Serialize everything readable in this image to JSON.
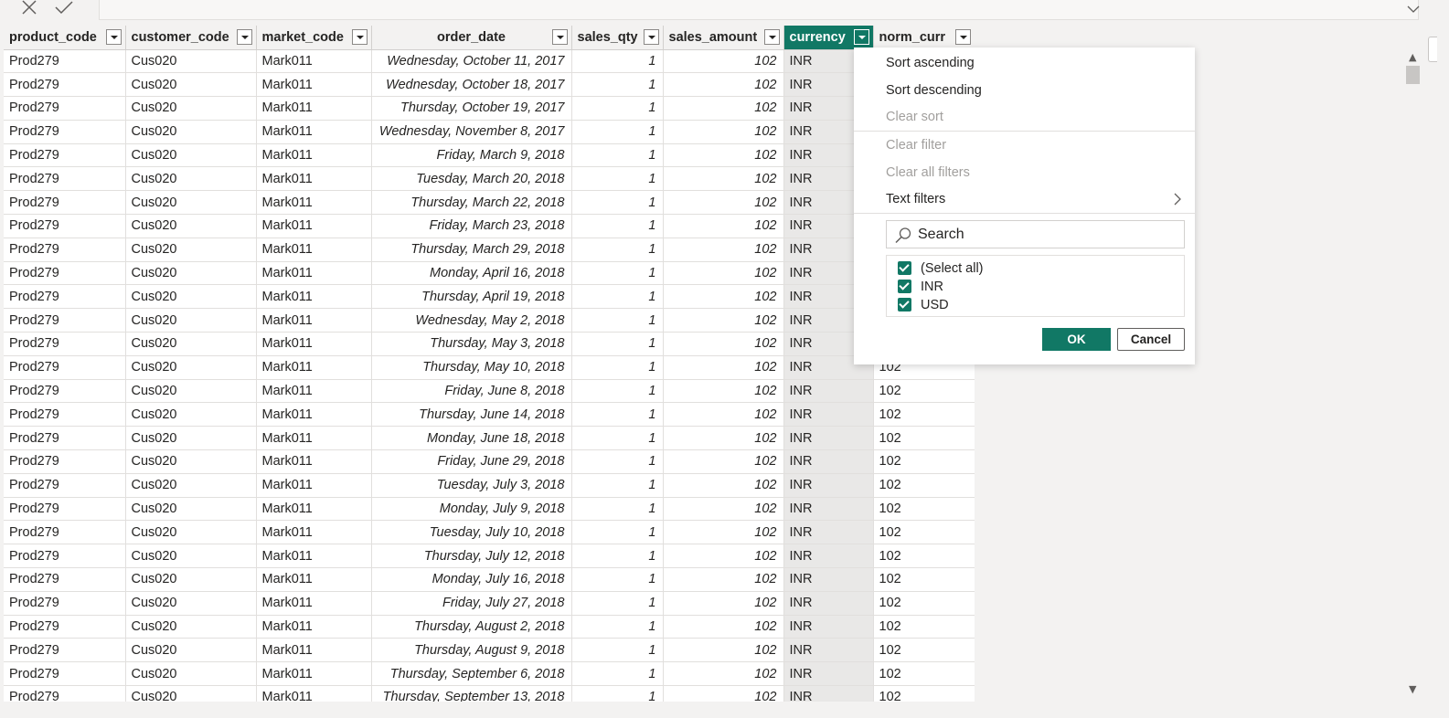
{
  "formula_bar": {
    "cancel_icon": "close-icon",
    "commit_icon": "check-icon",
    "expand_icon": "chevron-down-icon"
  },
  "columns": [
    {
      "label": "product_code",
      "dropdown": "chevron-down-icon"
    },
    {
      "label": "customer_code",
      "dropdown": "chevron-down-icon"
    },
    {
      "label": "market_code",
      "dropdown": "chevron-down-icon"
    },
    {
      "label": "order_date",
      "dropdown": "chevron-down-icon"
    },
    {
      "label": "sales_qty",
      "dropdown": "chevron-down-icon"
    },
    {
      "label": "sales_amount",
      "dropdown": "chevron-down-icon"
    },
    {
      "label": "currency",
      "dropdown": "chevron-down-icon",
      "active": true
    },
    {
      "label": "norm_curr",
      "dropdown": "chevron-down-icon"
    }
  ],
  "rows": [
    [
      "Prod279",
      "Cus020",
      "Mark011",
      "Wednesday, October 11, 2017",
      "1",
      "102",
      "INR",
      ""
    ],
    [
      "Prod279",
      "Cus020",
      "Mark011",
      "Wednesday, October 18, 2017",
      "1",
      "102",
      "INR",
      ""
    ],
    [
      "Prod279",
      "Cus020",
      "Mark011",
      "Thursday, October 19, 2017",
      "1",
      "102",
      "INR",
      ""
    ],
    [
      "Prod279",
      "Cus020",
      "Mark011",
      "Wednesday, November 8, 2017",
      "1",
      "102",
      "INR",
      ""
    ],
    [
      "Prod279",
      "Cus020",
      "Mark011",
      "Friday, March 9, 2018",
      "1",
      "102",
      "INR",
      ""
    ],
    [
      "Prod279",
      "Cus020",
      "Mark011",
      "Tuesday, March 20, 2018",
      "1",
      "102",
      "INR",
      ""
    ],
    [
      "Prod279",
      "Cus020",
      "Mark011",
      "Thursday, March 22, 2018",
      "1",
      "102",
      "INR",
      ""
    ],
    [
      "Prod279",
      "Cus020",
      "Mark011",
      "Friday, March 23, 2018",
      "1",
      "102",
      "INR",
      ""
    ],
    [
      "Prod279",
      "Cus020",
      "Mark011",
      "Thursday, March 29, 2018",
      "1",
      "102",
      "INR",
      ""
    ],
    [
      "Prod279",
      "Cus020",
      "Mark011",
      "Monday, April 16, 2018",
      "1",
      "102",
      "INR",
      ""
    ],
    [
      "Prod279",
      "Cus020",
      "Mark011",
      "Thursday, April 19, 2018",
      "1",
      "102",
      "INR",
      ""
    ],
    [
      "Prod279",
      "Cus020",
      "Mark011",
      "Wednesday, May 2, 2018",
      "1",
      "102",
      "INR",
      ""
    ],
    [
      "Prod279",
      "Cus020",
      "Mark011",
      "Thursday, May 3, 2018",
      "1",
      "102",
      "INR",
      ""
    ],
    [
      "Prod279",
      "Cus020",
      "Mark011",
      "Thursday, May 10, 2018",
      "1",
      "102",
      "INR",
      "102"
    ],
    [
      "Prod279",
      "Cus020",
      "Mark011",
      "Friday, June 8, 2018",
      "1",
      "102",
      "INR",
      "102"
    ],
    [
      "Prod279",
      "Cus020",
      "Mark011",
      "Thursday, June 14, 2018",
      "1",
      "102",
      "INR",
      "102"
    ],
    [
      "Prod279",
      "Cus020",
      "Mark011",
      "Monday, June 18, 2018",
      "1",
      "102",
      "INR",
      "102"
    ],
    [
      "Prod279",
      "Cus020",
      "Mark011",
      "Friday, June 29, 2018",
      "1",
      "102",
      "INR",
      "102"
    ],
    [
      "Prod279",
      "Cus020",
      "Mark011",
      "Tuesday, July 3, 2018",
      "1",
      "102",
      "INR",
      "102"
    ],
    [
      "Prod279",
      "Cus020",
      "Mark011",
      "Monday, July 9, 2018",
      "1",
      "102",
      "INR",
      "102"
    ],
    [
      "Prod279",
      "Cus020",
      "Mark011",
      "Tuesday, July 10, 2018",
      "1",
      "102",
      "INR",
      "102"
    ],
    [
      "Prod279",
      "Cus020",
      "Mark011",
      "Thursday, July 12, 2018",
      "1",
      "102",
      "INR",
      "102"
    ],
    [
      "Prod279",
      "Cus020",
      "Mark011",
      "Monday, July 16, 2018",
      "1",
      "102",
      "INR",
      "102"
    ],
    [
      "Prod279",
      "Cus020",
      "Mark011",
      "Friday, July 27, 2018",
      "1",
      "102",
      "INR",
      "102"
    ],
    [
      "Prod279",
      "Cus020",
      "Mark011",
      "Thursday, August 2, 2018",
      "1",
      "102",
      "INR",
      "102"
    ],
    [
      "Prod279",
      "Cus020",
      "Mark011",
      "Thursday, August 9, 2018",
      "1",
      "102",
      "INR",
      "102"
    ],
    [
      "Prod279",
      "Cus020",
      "Mark011",
      "Thursday, September 6, 2018",
      "1",
      "102",
      "INR",
      "102"
    ],
    [
      "Prod279",
      "Cus020",
      "Mark011",
      "Thursday, September 13, 2018",
      "1",
      "102",
      "INR",
      "102"
    ]
  ],
  "filter_menu": {
    "sort_ascending": "Sort ascending",
    "sort_descending": "Sort descending",
    "clear_sort": "Clear sort",
    "clear_filter": "Clear filter",
    "clear_all_filters": "Clear all filters",
    "text_filters": "Text filters",
    "search_placeholder": "Search",
    "options": [
      {
        "label": "(Select all)",
        "checked": true
      },
      {
        "label": "INR",
        "checked": true
      },
      {
        "label": "USD",
        "checked": true
      }
    ],
    "ok": "OK",
    "cancel": "Cancel"
  },
  "status_bar": "",
  "colors": {
    "accent": "#117865",
    "header_bg": "#f3f2f1",
    "selected_column_bg": "#e9e8e7"
  }
}
